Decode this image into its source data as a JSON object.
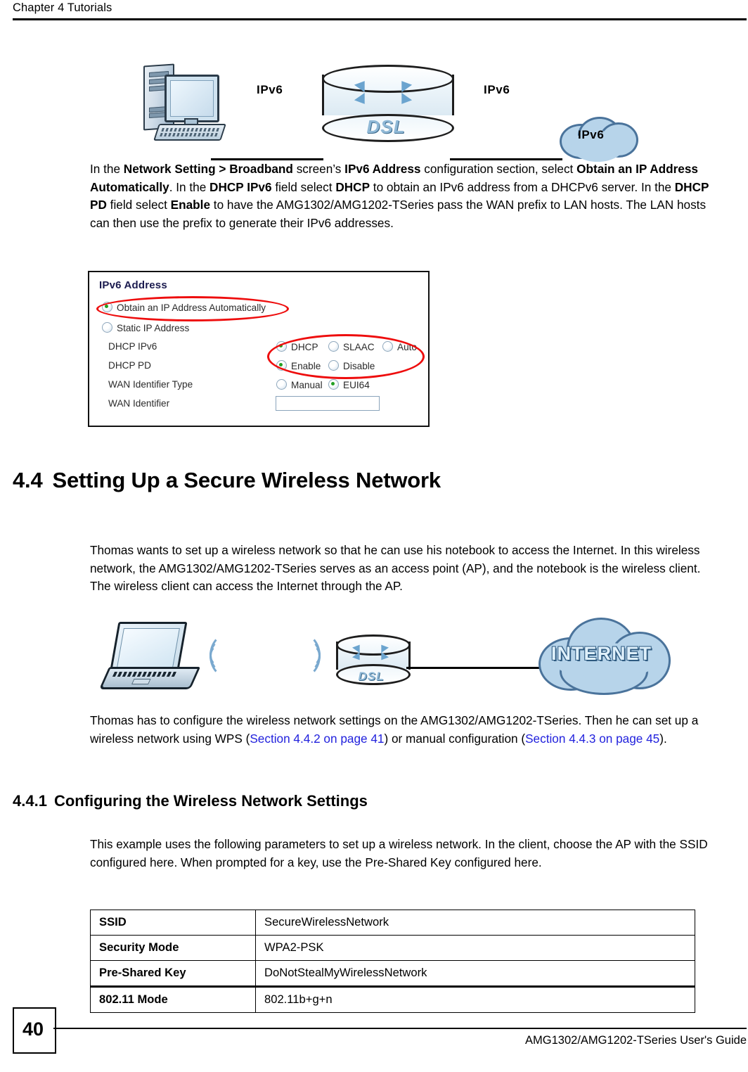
{
  "header": {
    "chapter": "Chapter 4 Tutorials"
  },
  "figure_ipv6": {
    "name": "ipv6-topology-diagram",
    "pc_label": "",
    "link_label_left": "IPv6",
    "link_label_right": "IPv6",
    "router_label": "DSL",
    "cloud_label": "IPv6"
  },
  "paragraph_ipv6": {
    "s1": "In the ",
    "b1": "Network Setting > Broadband",
    "s2": " screen’s ",
    "b2": "IPv6 Address",
    "s3": " configuration section, select ",
    "b3": "Obtain an IP Address Automatically",
    "s4": ". In the ",
    "b4": "DHCP IPv6",
    "s5": " field select ",
    "b5": "DHCP",
    "s6": " to obtain an IPv6 address from a DHCPv6 server. In the ",
    "b6": "DHCP PD",
    "s7": " field select ",
    "b7": "Enable",
    "s8": " to have the AMG1302/AMG1202-TSeries pass the WAN prefix to LAN hosts. The LAN hosts can then use the prefix to generate their IPv6 addresses."
  },
  "ui_panel": {
    "title": "IPv6 Address",
    "options": {
      "obtain_auto": "Obtain an IP Address Automatically",
      "static_ip": "Static IP Address"
    },
    "fields": [
      {
        "label": "DHCP IPv6"
      },
      {
        "label": "DHCP PD"
      },
      {
        "label": "WAN Identifier Type"
      },
      {
        "label": "WAN Identifier"
      }
    ],
    "dhcp_ipv6_choices": [
      "DHCP",
      "SLAAC",
      "Auto"
    ],
    "dhcp_ipv6_selected": "DHCP",
    "dhcp_pd_choices": [
      "Enable",
      "Disable"
    ],
    "dhcp_pd_selected": "Enable",
    "wan_id_type_choices": [
      "Manual",
      "EUI64"
    ],
    "wan_id_type_selected": "EUI64",
    "wan_identifier_value": "",
    "selected_address_mode": "Obtain an IP Address Automatically",
    "highlight_color": "#ee0d0d",
    "selected_dot_color": "#23a024"
  },
  "section_44": {
    "number": "4.4",
    "title": "Setting Up a Secure Wireless Network",
    "para1": "Thomas wants to set up a wireless network so that he can use his notebook to access the Internet. In this wireless network, the AMG1302/AMG1202-TSeries serves as an access point (AP), and the notebook is the wireless client. The wireless client can access the Internet through the AP.",
    "para2_a": "Thomas has to configure the wireless network settings on the AMG1302/AMG1202-TSeries. Then he can set up a wireless network using WPS (",
    "para2_link1": "Section 4.4.2 on page 41",
    "para2_b": ") or manual configuration (",
    "para2_link2": "Section 4.4.3 on page 45",
    "para2_c": ")."
  },
  "figure_wireless": {
    "name": "wireless-topology-diagram",
    "router_label": "DSL",
    "cloud_label": "INTERNET"
  },
  "section_441": {
    "number": "4.4.1",
    "title": "Configuring the Wireless Network Settings",
    "para": "This example uses the following parameters to set up a wireless network. In the client, choose the AP with the SSID configured here. When prompted for a key, use the Pre-Shared Key configured here."
  },
  "param_table": {
    "rows": [
      {
        "key": "SSID",
        "value": "SecureWirelessNetwork"
      },
      {
        "key": "Security Mode",
        "value": "WPA2-PSK"
      },
      {
        "key": "Pre-Shared Key",
        "value": "DoNotStealMyWirelessNetwork"
      },
      {
        "key": "802.11 Mode",
        "value": "802.11b+g+n"
      }
    ]
  },
  "footer": {
    "page_number": "40",
    "guide_title": "AMG1302/AMG1202-TSeries User's Guide"
  }
}
